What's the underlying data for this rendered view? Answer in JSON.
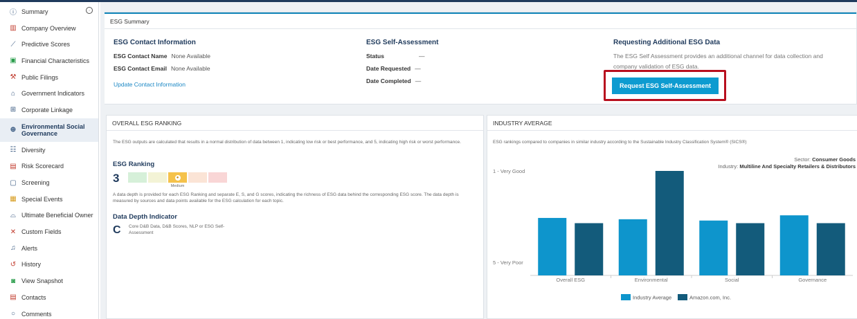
{
  "sidebar": {
    "items": [
      {
        "label": "Summary",
        "icon": "info-circle-icon",
        "glyph": "ⓘ"
      },
      {
        "label": "Company Overview",
        "icon": "building-icon",
        "glyph": "▥"
      },
      {
        "label": "Predictive Scores",
        "icon": "trend-chart-icon",
        "glyph": "⟋"
      },
      {
        "label": "Financial Characteristics",
        "icon": "money-icon",
        "glyph": "▣"
      },
      {
        "label": "Public Filings",
        "icon": "gavel-icon",
        "glyph": "⚒"
      },
      {
        "label": "Government Indicators",
        "icon": "government-icon",
        "glyph": "⌂"
      },
      {
        "label": "Corporate Linkage",
        "icon": "hierarchy-icon",
        "glyph": "⊞"
      },
      {
        "label": "Environmental Social Governance",
        "icon": "globe-icon",
        "glyph": "⊕"
      },
      {
        "label": "Diversity",
        "icon": "people-icon",
        "glyph": "☷"
      },
      {
        "label": "Risk Scorecard",
        "icon": "scorecard-icon",
        "glyph": "▤"
      },
      {
        "label": "Screening",
        "icon": "screening-icon",
        "glyph": "▢"
      },
      {
        "label": "Special Events",
        "icon": "events-icon",
        "glyph": "▦"
      },
      {
        "label": "Ultimate Beneficial Owner",
        "icon": "owner-icon",
        "glyph": "⌓"
      },
      {
        "label": "Custom Fields",
        "icon": "custom-fields-icon",
        "glyph": "✕"
      },
      {
        "label": "Alerts",
        "icon": "bell-icon",
        "glyph": "♫"
      },
      {
        "label": "History",
        "icon": "history-icon",
        "glyph": "↺"
      },
      {
        "label": "View Snapshot",
        "icon": "camera-icon",
        "glyph": "◙"
      },
      {
        "label": "Contacts",
        "icon": "contacts-icon",
        "glyph": "▤"
      },
      {
        "label": "Comments",
        "icon": "comment-icon",
        "glyph": "○"
      }
    ]
  },
  "esg_summary": {
    "header": "ESG Summary",
    "contact": {
      "title": "ESG Contact Information",
      "name_label": "ESG Contact Name",
      "name_value": "None Available",
      "email_label": "ESG Contact Email",
      "email_value": "None Available",
      "update_link": "Update Contact Information"
    },
    "self_assessment": {
      "title": "ESG Self-Assessment",
      "status_label": "Status",
      "status_value": "—",
      "requested_label": "Date Requested",
      "requested_value": "—",
      "completed_label": "Date Completed",
      "completed_value": "—"
    },
    "request": {
      "title": "Requesting Additional ESG Data",
      "description": "The ESG Self Assessment provides an additional channel for data collection and company validation of ESG data.",
      "button": "Request ESG Self-Assessment"
    }
  },
  "ranking": {
    "header": "OVERALL ESG RANKING",
    "description": "The ESG outputs are calculated that results in a normal distribution of data between 1, indicating low risk or best performance, and 5, indicating high risk or worst performance.",
    "label": "ESG Ranking",
    "value": "3",
    "medium_label": "Medium",
    "swatch_colors": [
      "#d6f0d9",
      "#f3f3d6",
      "#f5c24b",
      "#fbe4d6",
      "#f9d6d6"
    ],
    "depth_note": "A data depth is provided for each ESG Ranking and separate E, S, and G scores, indicating the richness of ESG data behind the corresponding ESG score. The data depth is measured by sources and data points available for the ESG calculation for each topic.",
    "depth_title": "Data Depth Indicator",
    "depth_value": "C",
    "depth_desc": "Core D&B Data, D&B Scores, NLP or ESG Self-Assessment"
  },
  "industry": {
    "header": "INDUSTRY AVERAGE",
    "description": "ESG rankings compared to companies in similar industry according to the Sustainable Industry Classification System® (SICS®)",
    "sector_label": "Sector:",
    "sector_value": "Consumer Goods",
    "industry_label": "Industry:",
    "industry_value": "Multiline And Specialty Retailers & Distributors"
  },
  "chart_data": {
    "type": "bar",
    "categories": [
      "Overall ESG",
      "Environmental",
      "Social",
      "Governance"
    ],
    "series": [
      {
        "name": "Industry Average",
        "color": "#0e95cc",
        "values": [
          2.8,
          2.85,
          2.9,
          2.7
        ]
      },
      {
        "name": "Amazon.com, Inc.",
        "color": "#135b7b",
        "values": [
          3.0,
          1.0,
          3.0,
          3.0
        ]
      }
    ],
    "ytick_labels": [
      "1 - Very Good",
      "5 - Very Poor"
    ],
    "yrange": [
      1,
      5
    ]
  }
}
